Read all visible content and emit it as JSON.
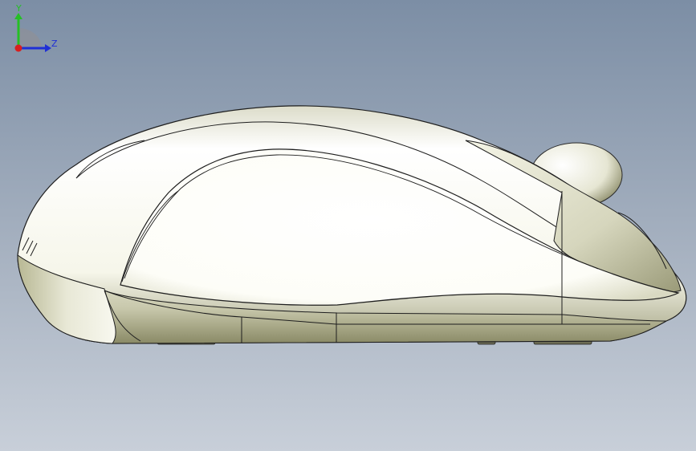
{
  "viewport": {
    "background_top": "#7f90a6",
    "background_bottom": "#c7ced8",
    "model_fill": "#fbfbf3",
    "model_shadow": "#8e8f6c",
    "edge_color": "#1e1e1e"
  },
  "triad": {
    "y_label": "Y",
    "z_label": "Z",
    "y_color": "#25c025",
    "z_color": "#1f2fd6",
    "x_color": "#d81f1f"
  }
}
